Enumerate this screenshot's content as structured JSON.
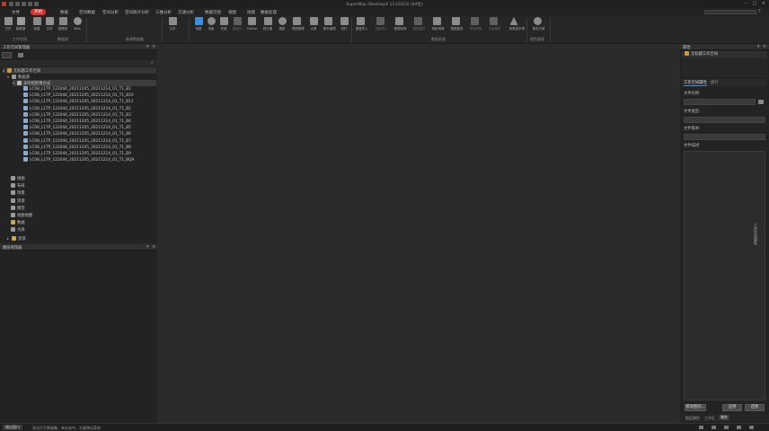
{
  "app": {
    "title": "SuperMap iDesktopX 11i(2023) (64位)"
  },
  "menubar": {
    "items": [
      "文件",
      "开始",
      "数据",
      "空间数据",
      "空间分析",
      "空间统计分析",
      "三维分析",
      "交通分析",
      "数据可视",
      "视图",
      "地图",
      "数据处理"
    ]
  },
  "ribbon": {
    "buttons": [
      {
        "label": "打开",
        "color": "#8e8e8e"
      },
      {
        "label": "数据源",
        "color": "#9a9a9a"
      },
      {
        "label": "新建",
        "color": "#8a8a8a"
      },
      {
        "label": "文件",
        "color": "#909090"
      },
      {
        "label": "数据库",
        "color": "#8a8a8a"
      },
      {
        "label": "Web",
        "color": "#909090"
      },
      {
        "label": "文本",
        "color": "#8c8c8c"
      },
      {
        "label": "地图",
        "color": "#3d8fd8"
      },
      {
        "label": "场景",
        "color": "#8b8b8b"
      },
      {
        "label": "布局",
        "color": "#8b8b8b"
      },
      {
        "label": "新窗口",
        "color": "#5f5f5f"
      },
      {
        "label": "Python",
        "color": "#8b8b8b"
      },
      {
        "label": "统计图",
        "color": "#8b8b8b"
      },
      {
        "label": "模型",
        "color": "#8b8b8b"
      },
      {
        "label": "视图管理",
        "color": "#8b8b8b"
      },
      {
        "label": "大屏",
        "color": "#8b8b8b"
      },
      {
        "label": "脚本管理",
        "color": "#8b8b8b"
      },
      {
        "label": "拓扑",
        "color": "#8b8b8b"
      },
      {
        "label": "数据导入",
        "color": "#8b8b8b"
      },
      {
        "label": "批量导入",
        "color": "#5f5f5f"
      },
      {
        "label": "数据转换",
        "color": "#8b8b8b"
      },
      {
        "label": "数据融合",
        "color": "#5f5f5f"
      },
      {
        "label": "投影转换",
        "color": "#8b8b8b"
      },
      {
        "label": "数据配准",
        "color": "#8b8b8b"
      },
      {
        "label": "坐标转换",
        "color": "#5f5f5f"
      },
      {
        "label": "矢量裁剪",
        "color": "#5f5f5f"
      },
      {
        "label": "影像金字塔",
        "color": "#8b8b8b"
      },
      {
        "label": "颜色方案",
        "color": "#8b8b8b"
      }
    ],
    "groups": [
      "工作空间",
      "数据源",
      "新建数据集",
      "数据处理",
      "颜色管理"
    ]
  },
  "workspace_manager": {
    "title": "工作空间管理器",
    "root": "无标题工作空间",
    "datasources_label": "数据源",
    "datasource_name": "多时相影像合成",
    "datasets": [
      "LC08_L1TP_122044_20211205_20211214_01_T1_B1",
      "LC08_L1TP_122044_20211205_20211214_01_T1_B10",
      "LC08_L1TP_122044_20211205_20211214_01_T1_B11",
      "LC08_L1TP_122044_20211205_20211214_01_T1_B2",
      "LC08_L1TP_122044_20211205_20211214_01_T1_B3",
      "LC08_L1TP_122044_20211205_20211214_01_T1_B4",
      "LC08_L1TP_122044_20211205_20211214_01_T1_B5",
      "LC08_L1TP_122044_20211205_20211214_01_T1_B6",
      "LC08_L1TP_122044_20211205_20211214_01_T1_B7",
      "LC08_L1TP_122044_20211205_20211214_01_T1_B8",
      "LC08_L1TP_122044_20211205_20211214_01_T1_B9",
      "LC08_L1TP_122044_20211205_20211214_01_T1_BQA"
    ],
    "other_nodes": [
      "地图",
      "布局",
      "场景",
      "资源",
      "模型",
      "地图地图",
      "数据",
      "大屏",
      "资源"
    ]
  },
  "layer_manager": {
    "title": "图层管理器"
  },
  "properties": {
    "title": "属性",
    "header_item": "无标题工作空间",
    "tabs": [
      "工作空间属性",
      "统计"
    ],
    "fields": [
      {
        "label": "文件名称:",
        "value": ""
      },
      {
        "label": "文件类型:",
        "value": ""
      },
      {
        "label": "文件版本:",
        "value": ""
      },
      {
        "label": "文件描述:",
        "value": ""
      }
    ],
    "buttons": [
      "修改密码...",
      "应用",
      "还原"
    ],
    "bottom_tabs": [
      "图层属性",
      "工作区",
      "属性"
    ],
    "side_label": "工作空间属性"
  },
  "statusbar": {
    "tab": "输出窗口",
    "message": "双击打开数据集，单击选中，右键弹出菜单"
  }
}
